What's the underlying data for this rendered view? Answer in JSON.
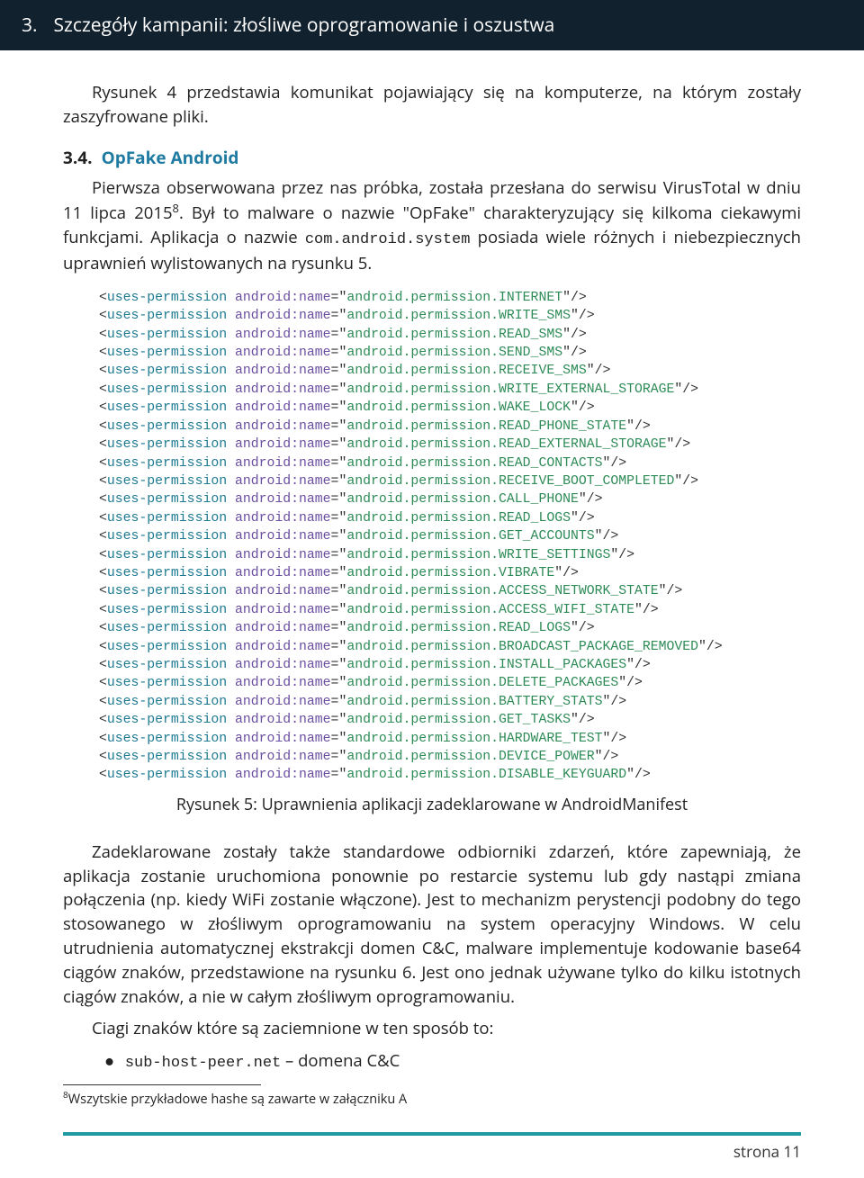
{
  "header": {
    "number": "3.",
    "title": "Szczegóły kampanii: złośliwe oprogramowanie i oszustwa"
  },
  "intro": "Rysunek 4 przedstawia komunikat pojawiający się na komputerze, na którym zostały zaszyfrowane pliki.",
  "section": {
    "num": "3.4.",
    "title": "OpFake Android"
  },
  "para1_a": "Pierwsza obserwowana przez nas próbka, została przesłana do serwisu VirusTotal w dniu 11 lipca 2015",
  "para1_sup": "8",
  "para1_b": ". Był to malware o nazwie \"OpFake\" charakteryzujący się kilkoma ciekawymi funkcjami. Aplikacja o nazwie ",
  "para1_code": "com.android.system",
  "para1_c": " posiada wiele różnych i niebezpiecznych uprawnień wylistowanych na rysunku 5.",
  "permissions": [
    "android.permission.INTERNET",
    "android.permission.WRITE_SMS",
    "android.permission.READ_SMS",
    "android.permission.SEND_SMS",
    "android.permission.RECEIVE_SMS",
    "android.permission.WRITE_EXTERNAL_STORAGE",
    "android.permission.WAKE_LOCK",
    "android.permission.READ_PHONE_STATE",
    "android.permission.READ_EXTERNAL_STORAGE",
    "android.permission.READ_CONTACTS",
    "android.permission.RECEIVE_BOOT_COMPLETED",
    "android.permission.CALL_PHONE",
    "android.permission.READ_LOGS",
    "android.permission.GET_ACCOUNTS",
    "android.permission.WRITE_SETTINGS",
    "android.permission.VIBRATE",
    "android.permission.ACCESS_NETWORK_STATE",
    "android.permission.ACCESS_WIFI_STATE",
    "android.permission.READ_LOGS",
    "android.permission.BROADCAST_PACKAGE_REMOVED",
    "android.permission.INSTALL_PACKAGES",
    "android.permission.DELETE_PACKAGES",
    "android.permission.BATTERY_STATS",
    "android.permission.GET_TASKS",
    "android.permission.HARDWARE_TEST",
    "android.permission.DEVICE_POWER",
    "android.permission.DISABLE_KEYGUARD"
  ],
  "xml": {
    "tag": "uses-permission",
    "attr": "android:name"
  },
  "caption": "Rysunek 5: Uprawnienia aplikacji zadeklarowane w AndroidManifest",
  "para2": "Zadeklarowane zostały także standardowe odbiorniki zdarzeń, które zapewniają, że aplikacja zostanie uruchomiona ponownie po restarcie systemu lub gdy nastąpi zmiana połączenia (np. kiedy WiFi zostanie włączone). Jest to mechanizm perystencji podobny do tego stosowanego w złośliwym oprogramowaniu na system operacyjny Windows. W celu utrudnienia automatycznej ekstrakcji domen C&C, malware implementuje kodowanie base64 ciągów znaków, przedstawione na rysunku 6. Jest ono jednak używane tylko do kilku istotnych ciągów znaków, a nie w całym złośliwym oprogramowaniu.",
  "para3": "Ciagi znaków które są zaciemnione w ten sposób to:",
  "bullet_code": "sub-host-peer.net",
  "bullet_text": " – domena C&C",
  "footnote_sup": "8",
  "footnote_text": "Wszytskie przykładowe hashe są zawarte w załączniku A",
  "page_label": "strona 11"
}
